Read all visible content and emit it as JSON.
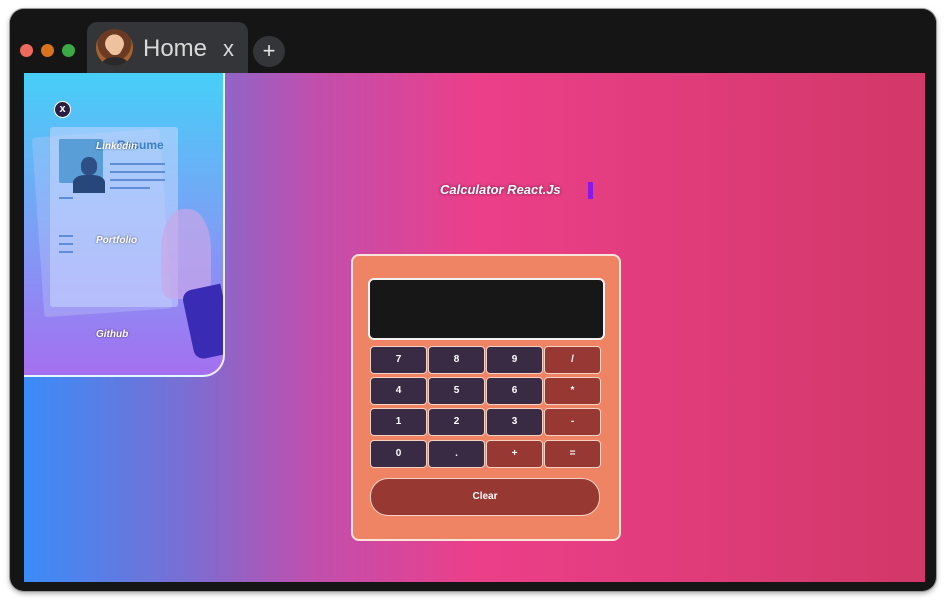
{
  "browser": {
    "tab": {
      "title": "Home",
      "close_label": "x",
      "avatar_icon": "user-avatar"
    },
    "new_tab_label": "+",
    "traffic_lights": [
      "#ee6a5f",
      "#d9731d",
      "#3caa44"
    ]
  },
  "sidebar": {
    "close_label": "x",
    "resume_title": "Resume",
    "links": [
      {
        "label": "Linkedin"
      },
      {
        "label": "Portfolio"
      },
      {
        "label": "Github"
      }
    ]
  },
  "main": {
    "title": "Calculator React.Js",
    "cursor_color": "#8a18e8"
  },
  "calculator": {
    "display_value": "",
    "keys": [
      [
        "7",
        "8",
        "9",
        "/"
      ],
      [
        "4",
        "5",
        "6",
        "*"
      ],
      [
        "1",
        "2",
        "3",
        "-"
      ],
      [
        "0",
        ".",
        "+",
        "="
      ]
    ],
    "clear_label": "Clear",
    "colors": {
      "body": "#ee8464",
      "number_key": "#3a2b45",
      "operator_key": "#983832"
    }
  }
}
